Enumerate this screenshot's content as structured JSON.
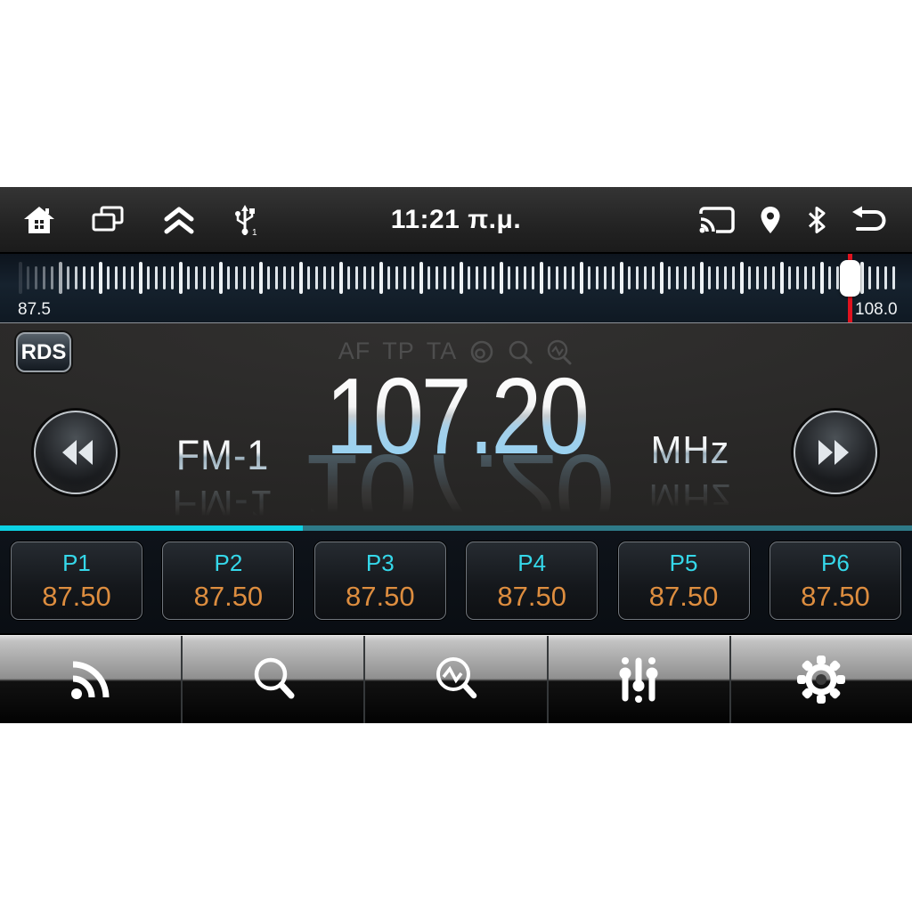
{
  "status_bar": {
    "time": "11:21 π.μ.",
    "left_icons": [
      "home-icon",
      "recents-icon",
      "collapse-icon",
      "usb-icon"
    ],
    "right_icons": [
      "cast-icon",
      "location-icon",
      "bluetooth-icon",
      "back-icon"
    ]
  },
  "tuner_scale": {
    "min_label": "87.5",
    "max_label": "108.0",
    "pointer_color": "#e0131f"
  },
  "radio": {
    "rds_badge": "RDS",
    "flags": {
      "af": "AF",
      "tp": "TP",
      "ta": "TA"
    },
    "flag_icons": [
      "pty-circle-icon",
      "search-icon",
      "scan-icon"
    ],
    "band": "FM-1",
    "frequency": "107.20",
    "unit": "MHz"
  },
  "presets": [
    {
      "label": "P1",
      "freq": "87.50"
    },
    {
      "label": "P2",
      "freq": "87.50"
    },
    {
      "label": "P3",
      "freq": "87.50"
    },
    {
      "label": "P4",
      "freq": "87.50"
    },
    {
      "label": "P5",
      "freq": "87.50"
    },
    {
      "label": "P6",
      "freq": "87.50"
    }
  ],
  "toolbar": {
    "icons": [
      "broadcast-icon",
      "search-icon",
      "scan-icon",
      "equalizer-icon",
      "settings-gear-icon"
    ]
  },
  "colors": {
    "accent_bright": "#0cd2e4",
    "accent_dim": "#2e7a88",
    "preset_label": "#35d8ea",
    "preset_value": "#dd8d3f"
  }
}
